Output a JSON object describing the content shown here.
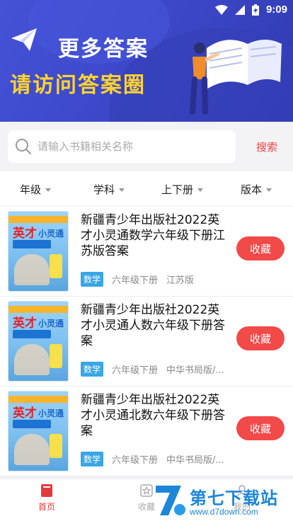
{
  "status_bar": {
    "time": "9:09"
  },
  "banner": {
    "title_line1": "更多答案",
    "title_line2": "请访问答案圈"
  },
  "search": {
    "placeholder": "请输入书籍相关名称",
    "button_label": "搜索"
  },
  "filters": [
    {
      "label": "年级"
    },
    {
      "label": "学科"
    },
    {
      "label": "上下册"
    },
    {
      "label": "版本"
    }
  ],
  "books": [
    {
      "title": "新疆青少年出版社2022英才小灵通数学六年级下册江苏版答案",
      "subject": "数学",
      "grade": "六年级下册",
      "edition": "江苏版",
      "action": "收藏",
      "cover": {
        "brand": "英才",
        "series": "小灵通"
      }
    },
    {
      "title": "新疆青少年出版社2022英才小灵通人数六年级下册答案",
      "subject": "数学",
      "grade": "六年级下册",
      "edition": "中华书局版/...",
      "action": "收藏",
      "cover": {
        "brand": "英才",
        "series": "小灵通"
      }
    },
    {
      "title": "新疆青少年出版社2022英才小灵通北数六年级下册答案",
      "subject": "数学",
      "grade": "六年级下册",
      "edition": "中华书局版/...",
      "action": "收藏",
      "cover": {
        "brand": "英才",
        "series": "小灵通"
      }
    }
  ],
  "bottom_nav": {
    "home": "首页",
    "favorites": "收藏",
    "mine": "我的"
  },
  "watermark": {
    "name": "第七下载站",
    "url": "www.d7down.com"
  },
  "colors": {
    "banner_blue": "#3a45c4",
    "accent_red": "#f24949",
    "badge_blue": "#39a6e6",
    "title_yellow": "#ffd330"
  }
}
